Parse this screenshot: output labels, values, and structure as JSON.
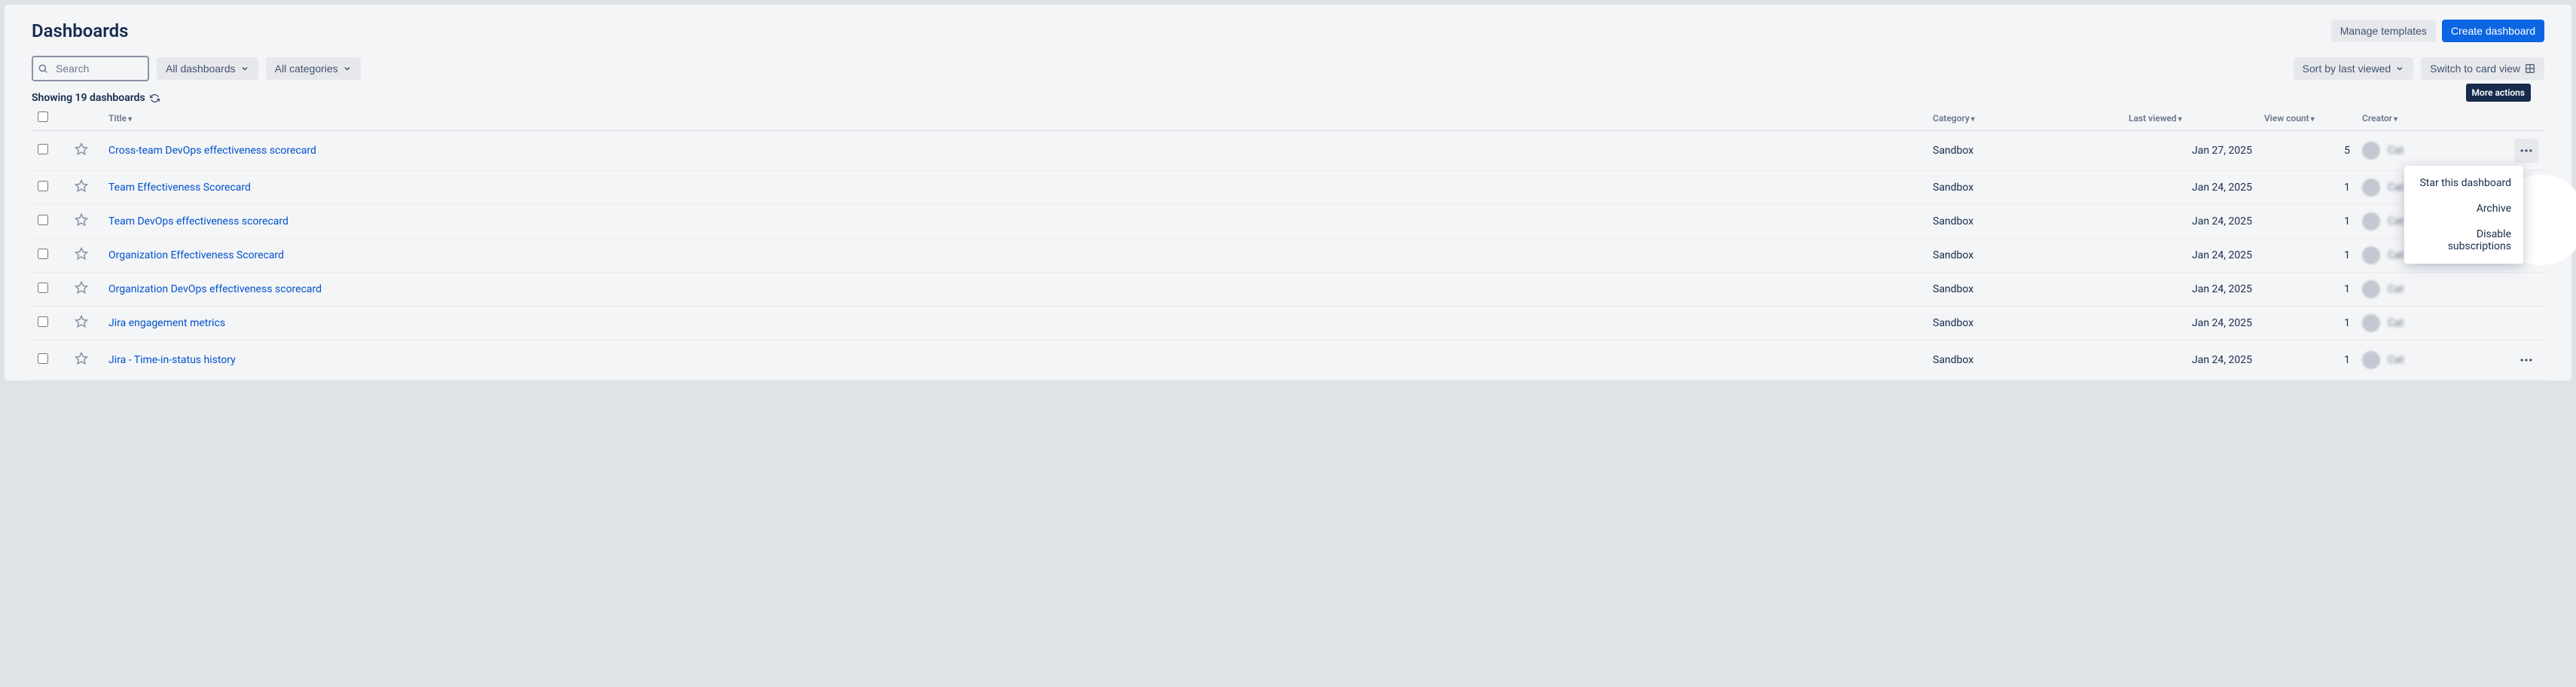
{
  "header": {
    "title": "Dashboards",
    "manage_templates_label": "Manage templates",
    "create_dashboard_label": "Create dashboard"
  },
  "toolbar": {
    "search_placeholder": "Search",
    "all_dashboards_label": "All dashboards",
    "all_categories_label": "All categories",
    "sort_label": "Sort by last viewed",
    "switch_view_label": "Switch to card view"
  },
  "summary": {
    "showing_text": "Showing 19 dashboards"
  },
  "columns": {
    "title": "Title",
    "category": "Category",
    "last_viewed": "Last viewed",
    "view_count": "View count",
    "creator": "Creator"
  },
  "tooltip": {
    "more_actions": "More actions"
  },
  "menu": {
    "star": "Star this dashboard",
    "archive": "Archive",
    "disable_subs": "Disable subscriptions"
  },
  "rows": [
    {
      "title": "Cross-team DevOps effectiveness scorecard",
      "category": "Sandbox",
      "last_viewed": "Jan 27, 2025",
      "views": "5",
      "creator": "Cat"
    },
    {
      "title": "Team Effectiveness Scorecard",
      "category": "Sandbox",
      "last_viewed": "Jan 24, 2025",
      "views": "1",
      "creator": "Cat"
    },
    {
      "title": "Team DevOps effectiveness scorecard",
      "category": "Sandbox",
      "last_viewed": "Jan 24, 2025",
      "views": "1",
      "creator": "Cat"
    },
    {
      "title": "Organization Effectiveness Scorecard",
      "category": "Sandbox",
      "last_viewed": "Jan 24, 2025",
      "views": "1",
      "creator": "Cat"
    },
    {
      "title": "Organization DevOps effectiveness scorecard",
      "category": "Sandbox",
      "last_viewed": "Jan 24, 2025",
      "views": "1",
      "creator": "Cat"
    },
    {
      "title": "Jira engagement metrics",
      "category": "Sandbox",
      "last_viewed": "Jan 24, 2025",
      "views": "1",
      "creator": "Cat"
    },
    {
      "title": "Jira - Time-in-status history",
      "category": "Sandbox",
      "last_viewed": "Jan 24, 2025",
      "views": "1",
      "creator": "Cat"
    }
  ]
}
